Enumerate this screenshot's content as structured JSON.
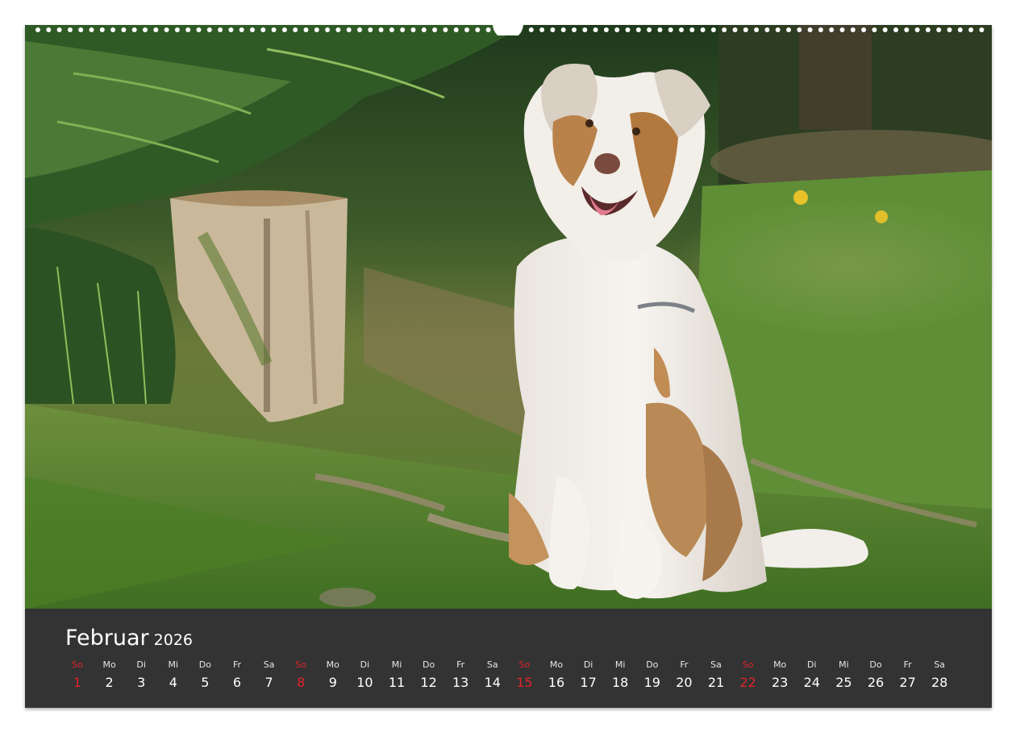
{
  "calendar": {
    "month": "Februar",
    "year": "2026",
    "days": [
      {
        "abbr": "So",
        "num": "1",
        "sunday": true
      },
      {
        "abbr": "Mo",
        "num": "2"
      },
      {
        "abbr": "Di",
        "num": "3"
      },
      {
        "abbr": "Mi",
        "num": "4"
      },
      {
        "abbr": "Do",
        "num": "5"
      },
      {
        "abbr": "Fr",
        "num": "6"
      },
      {
        "abbr": "Sa",
        "num": "7"
      },
      {
        "abbr": "So",
        "num": "8",
        "sunday": true
      },
      {
        "abbr": "Mo",
        "num": "9"
      },
      {
        "abbr": "Di",
        "num": "10"
      },
      {
        "abbr": "Mi",
        "num": "11"
      },
      {
        "abbr": "Do",
        "num": "12"
      },
      {
        "abbr": "Fr",
        "num": "13"
      },
      {
        "abbr": "Sa",
        "num": "14"
      },
      {
        "abbr": "So",
        "num": "15",
        "sunday": true
      },
      {
        "abbr": "Mo",
        "num": "16"
      },
      {
        "abbr": "Di",
        "num": "17"
      },
      {
        "abbr": "Mi",
        "num": "18"
      },
      {
        "abbr": "Do",
        "num": "19"
      },
      {
        "abbr": "Fr",
        "num": "20"
      },
      {
        "abbr": "Sa",
        "num": "21"
      },
      {
        "abbr": "So",
        "num": "22",
        "sunday": true
      },
      {
        "abbr": "Mo",
        "num": "23"
      },
      {
        "abbr": "Di",
        "num": "24"
      },
      {
        "abbr": "Mi",
        "num": "25"
      },
      {
        "abbr": "Do",
        "num": "26"
      },
      {
        "abbr": "Fr",
        "num": "27"
      },
      {
        "abbr": "Sa",
        "num": "28"
      }
    ]
  },
  "colors": {
    "strip": "#333333",
    "sunday": "#e0242c",
    "text": "#ffffff"
  }
}
